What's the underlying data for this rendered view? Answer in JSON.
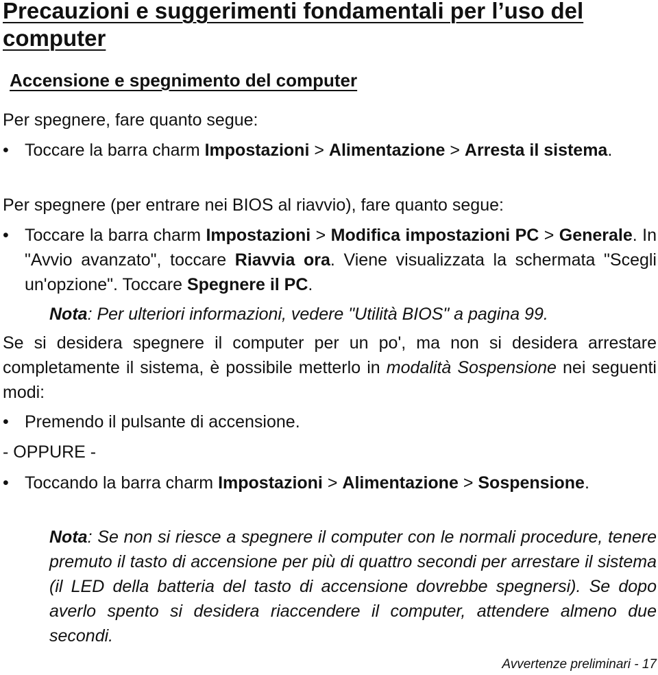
{
  "title": "Precauzioni e suggerimenti fondamentali per l’uso del computer",
  "section_title": "Accensione e spegnimento del computer",
  "intro1": "Per spegnere, fare quanto segue:",
  "bullet1": {
    "a": "Toccare la barra charm ",
    "b1": "Impostazioni",
    "sep1": " > ",
    "b2": "Alimentazione",
    "sep2": " > ",
    "b3": "Arresta il sistema",
    "end": "."
  },
  "intro2": "Per spegnere (per entrare nei BIOS al riavvio), fare quanto segue:",
  "bullet2": {
    "a": "Toccare la barra charm ",
    "b1": "Impostazioni",
    "sep1": " > ",
    "b2": "Modifica impostazioni PC",
    "sep2": " > ",
    "b3": "Generale",
    "c": ". In \"Avvio avanzato\", toccare ",
    "b4": "Riavvia ora",
    "d": ". Viene visualizzata la schermata \"Scegli un'opzione\". Toccare ",
    "b5": "Spegnere il PC",
    "end": "."
  },
  "note1": {
    "label": "Nota",
    "text": ": Per ulteriori informazioni, vedere \"Utilità BIOS\" a pagina 99."
  },
  "para3": {
    "a": "Se si desidera spegnere il computer per un po', ma non si desidera arrestare completamente il sistema, è possibile metterlo in ",
    "i": "modalità Sospensione",
    "b": " nei seguenti modi:"
  },
  "bullet3": "Premendo il pulsante di accensione.",
  "oppure": "- OPPURE -",
  "bullet4": {
    "a": "Toccando la barra charm ",
    "b1": "Impostazioni",
    "sep1": " > ",
    "b2": "Alimentazione",
    "sep2": " > ",
    "b3": "Sospensione",
    "end": "."
  },
  "note2": {
    "label": "Nota",
    "text": ": Se non si riesce a spegnere il computer con le normali procedure, tenere premuto il tasto di accensione per più di quattro secondi per arrestare il sistema (il LED della batteria del tasto di accensione dovrebbe spegnersi). Se dopo averlo spento si desidera riaccendere il computer, attendere almeno due secondi."
  },
  "footer": "Avvertenze preliminari -  17",
  "bullet_glyph": "•"
}
